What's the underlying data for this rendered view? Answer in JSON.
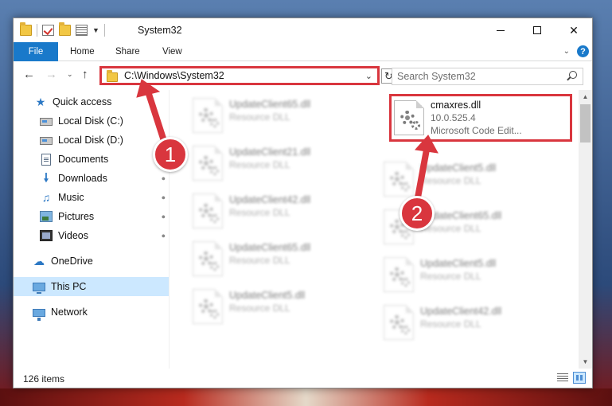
{
  "window": {
    "title": "System32"
  },
  "ribbon": {
    "file_tab": "File",
    "home_tab": "Home",
    "share_tab": "Share",
    "view_tab": "View"
  },
  "address": {
    "path": "C:\\Windows\\System32"
  },
  "search": {
    "placeholder": "Search System32"
  },
  "sidebar": {
    "items": [
      {
        "label": "Quick access",
        "icon": "star-icon"
      },
      {
        "label": "Local Disk (C:)",
        "icon": "disk-icon"
      },
      {
        "label": "Local Disk (D:)",
        "icon": "disk-icon"
      },
      {
        "label": "Documents",
        "icon": "document-icon"
      },
      {
        "label": "Downloads",
        "icon": "download-icon"
      },
      {
        "label": "Music",
        "icon": "music-icon"
      },
      {
        "label": "Pictures",
        "icon": "pictures-icon"
      },
      {
        "label": "Videos",
        "icon": "videos-icon"
      },
      {
        "label": "OneDrive",
        "icon": "cloud-icon"
      },
      {
        "label": "This PC",
        "icon": "computer-icon"
      },
      {
        "label": "Network",
        "icon": "network-icon"
      }
    ]
  },
  "files": {
    "left_column": [
      {
        "name": "UpdateClient65.dll",
        "type": "Resource DLL"
      },
      {
        "name": "UpdateClient21.dll",
        "type": "Resource DLL"
      },
      {
        "name": "UpdateClient42.dll",
        "type": "Resource DLL"
      },
      {
        "name": "UpdateClient65.dll",
        "type": "Resource DLL"
      },
      {
        "name": "UpdateClient5.dll",
        "type": "Resource DLL"
      }
    ],
    "highlighted": {
      "name": "cmaxres.dll",
      "version": "10.0.525.4",
      "description": "Microsoft Code Edit..."
    },
    "right_column": [
      {
        "name": "UpdateClient5.dll",
        "type": "Resource DLL"
      },
      {
        "name": "UpdateClient65.dll",
        "type": "Resource DLL"
      },
      {
        "name": "UpdateClient5.dll",
        "type": "Resource DLL"
      },
      {
        "name": "UpdateClient42.dll",
        "type": "Resource DLL"
      }
    ]
  },
  "status": {
    "item_count": "126 items"
  },
  "callouts": {
    "first": "1",
    "second": "2"
  },
  "colors": {
    "accent": "#1979ca",
    "highlight_red": "#d9363e",
    "selection": "#cce8ff"
  }
}
